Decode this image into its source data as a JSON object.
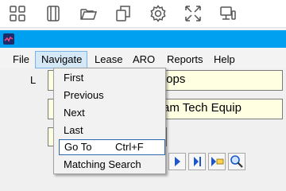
{
  "toolbar": {
    "icons": [
      "grid-icon",
      "tablet-icon",
      "folder-open-icon",
      "copy-icon",
      "gear-icon",
      "expand-icon",
      "devices-icon"
    ]
  },
  "menubar": {
    "items": [
      "File",
      "Navigate",
      "Lease",
      "ARO",
      "Reports",
      "Help"
    ]
  },
  "navigate_menu": {
    "items": [
      {
        "label": "First",
        "shortcut": ""
      },
      {
        "label": "Previous",
        "shortcut": ""
      },
      {
        "label": "Next",
        "shortcut": ""
      },
      {
        "label": "Last",
        "shortcut": ""
      },
      {
        "label": "Go To",
        "shortcut": "Ctrl+F"
      },
      {
        "label": "Matching Search",
        "shortcut": ""
      }
    ]
  },
  "form": {
    "label_partial": "L",
    "field1_value": "tops",
    "field2_value": "am Tech Equip",
    "field3_value": ""
  },
  "nav_buttons": [
    "next-record-icon",
    "last-record-icon",
    "new-record-icon",
    "search-icon"
  ],
  "colors": {
    "titlebar": "#00a0f0",
    "field_background": "#ffffe1",
    "menu_highlight_border": "#2a69b0",
    "nav_arrow": "#1c56c8"
  }
}
